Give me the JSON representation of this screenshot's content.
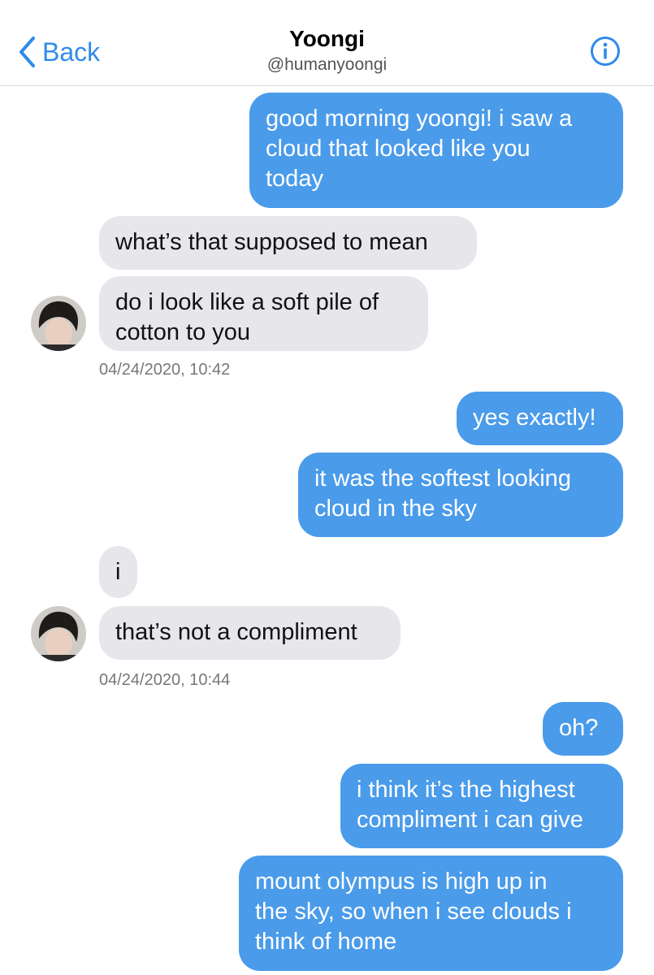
{
  "header": {
    "back_label": "Back",
    "name": "Yoongi",
    "handle": "@humanyoongi"
  },
  "icons": {
    "back": "chevron-left-icon",
    "info": "info-icon",
    "accent_color": "#2f8bea"
  },
  "messages": [
    {
      "dir": "out",
      "lines": [
        "good morning yoongi! i saw a",
        "cloud that looked like you",
        "today"
      ]
    },
    {
      "dir": "in",
      "lines": [
        "what’s that supposed to mean"
      ]
    },
    {
      "dir": "in",
      "lines": [
        "do i look like a soft pile of",
        "cotton to you"
      ]
    },
    {
      "dir": "out",
      "lines": [
        "yes exactly!"
      ]
    },
    {
      "dir": "out",
      "lines": [
        "it was the softest looking",
        "cloud in the sky"
      ]
    },
    {
      "dir": "in",
      "lines": [
        "i"
      ]
    },
    {
      "dir": "in",
      "lines": [
        "that’s not a compliment"
      ]
    },
    {
      "dir": "out",
      "lines": [
        "oh?"
      ]
    },
    {
      "dir": "out",
      "lines": [
        "i think it’s the highest",
        "compliment i can give"
      ]
    },
    {
      "dir": "out",
      "lines": [
        "mount olympus is high up in",
        "the sky, so when i see clouds i",
        "think of home"
      ]
    }
  ],
  "timestamps": [
    "04/24/2020, 10:42",
    "04/24/2020, 10:44"
  ],
  "colors": {
    "outgoing_bubble": "#4a9bea",
    "incoming_bubble": "#e6e6eb"
  }
}
